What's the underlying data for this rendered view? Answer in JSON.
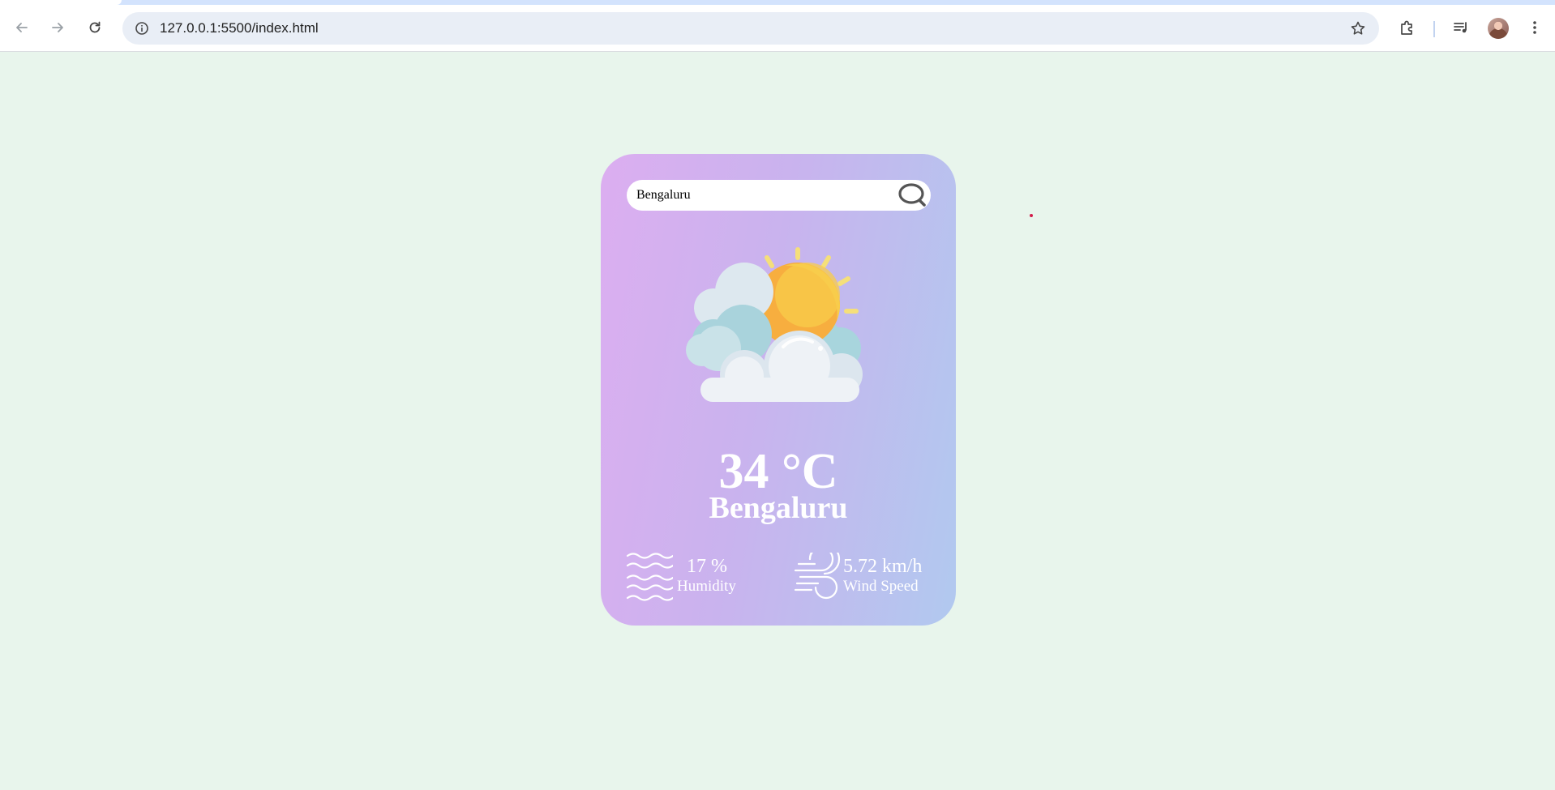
{
  "browser": {
    "url": "127.0.0.1:5500/index.html",
    "icons": {
      "back": "back-arrow-icon",
      "forward": "forward-arrow-icon",
      "reload": "reload-icon",
      "site_info": "info-icon",
      "bookmark": "star-icon",
      "extensions": "puzzle-icon",
      "media": "media-control-icon",
      "profile": "avatar",
      "menu": "kebab-menu-icon"
    }
  },
  "weather": {
    "search_value": "Bengaluru",
    "temperature": "34 °C",
    "city": "Bengaluru",
    "humidity_value": "17 %",
    "humidity_label": "Humidity",
    "wind_value": "5.72 km/h",
    "wind_label": "Wind Speed",
    "condition_icon": "partly-cloudy-sun-icon"
  },
  "colors": {
    "page_background": "#e8f5ec",
    "card_gradient_start": "#dcaef0",
    "card_gradient_end": "#b1c9ef",
    "text": "#ffffff"
  }
}
